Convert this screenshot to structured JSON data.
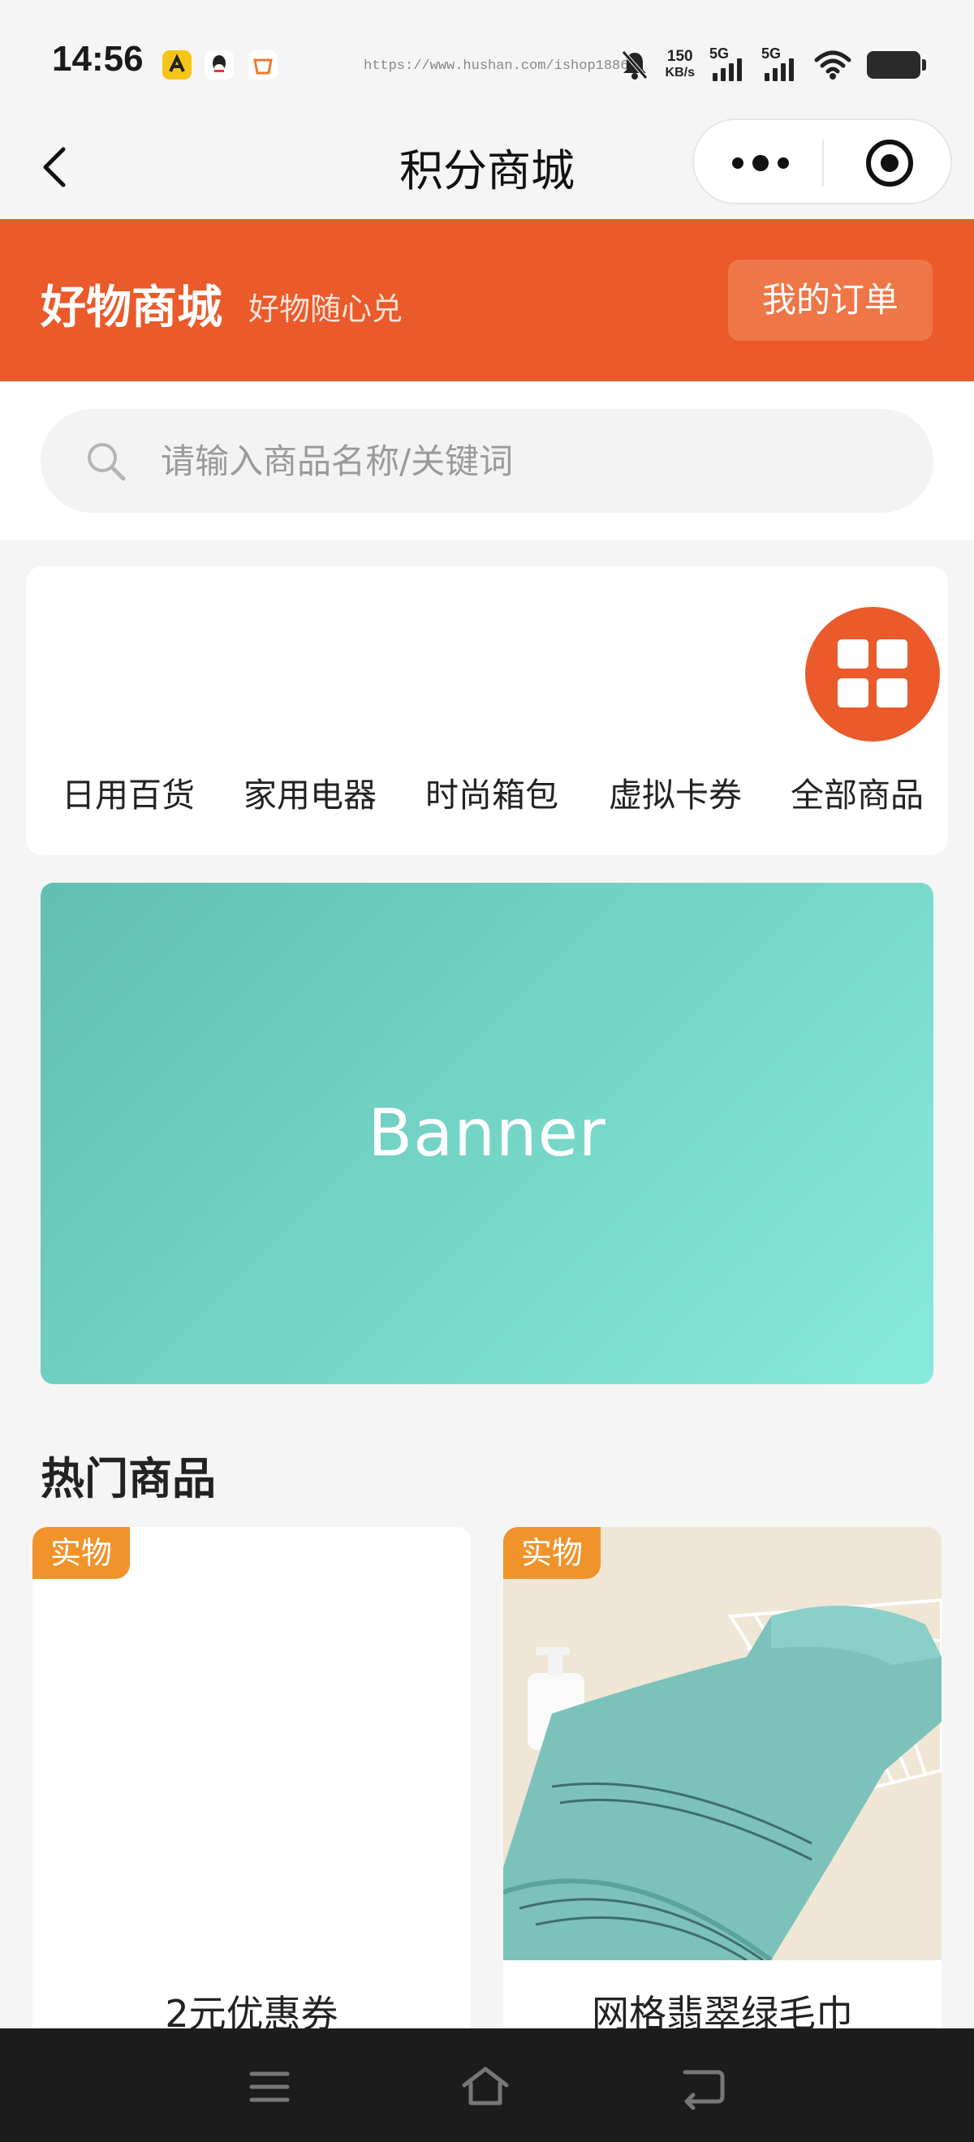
{
  "status": {
    "time": "14:56",
    "url": "https://www.hushan.com/ishop18862",
    "net_speed_value": "150",
    "net_speed_unit": "KB/s",
    "sim1": "5G",
    "sim2": "5G"
  },
  "nav": {
    "title": "积分商城"
  },
  "header": {
    "title": "好物商城",
    "subtitle": "好物随心兑",
    "orders_label": "我的订单",
    "color": "#ea5a2b"
  },
  "search": {
    "placeholder": "请输入商品名称/关键词"
  },
  "categories": [
    {
      "label": "日用百货"
    },
    {
      "label": "家用电器"
    },
    {
      "label": "时尚箱包"
    },
    {
      "label": "虚拟卡券"
    },
    {
      "label": "全部商品",
      "icon": "grid-icon"
    }
  ],
  "banner": {
    "text": "Banner"
  },
  "hot": {
    "title": "热门商品",
    "products": [
      {
        "tag": "实物",
        "name": "2元优惠券"
      },
      {
        "tag": "实物",
        "name": "网格翡翠绿毛巾"
      }
    ]
  }
}
